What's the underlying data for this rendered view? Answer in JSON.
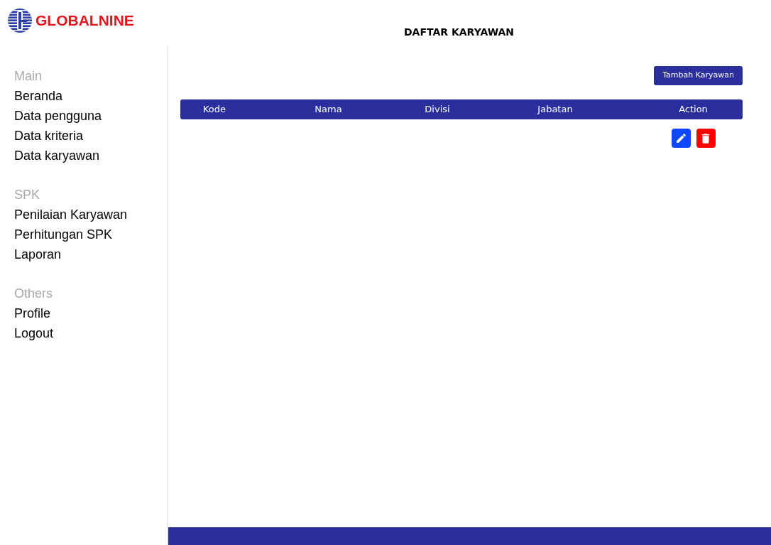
{
  "brand": {
    "name": "GLOBALNINE"
  },
  "title": "DAFTAR KARYAWAN",
  "sidebar": {
    "sections": [
      {
        "heading": "Main",
        "items": [
          {
            "label": "Beranda"
          },
          {
            "label": "Data pengguna"
          },
          {
            "label": "Data kriteria"
          },
          {
            "label": "Data karyawan"
          }
        ]
      },
      {
        "heading": "SPK",
        "items": [
          {
            "label": "Penilaian Karyawan"
          },
          {
            "label": "Perhitungan SPK"
          },
          {
            "label": "Laporan"
          }
        ]
      },
      {
        "heading": "Others",
        "items": [
          {
            "label": "Profile"
          },
          {
            "label": "Logout"
          }
        ]
      }
    ]
  },
  "add_button": "Tambah Karyawan",
  "table": {
    "columns": [
      "Kode",
      "Nama",
      "Divisi",
      "Jabatan",
      "Action"
    ],
    "rows": [
      {
        "actions": [
          {
            "kind": "edit"
          },
          {
            "kind": "delete"
          }
        ]
      }
    ]
  }
}
